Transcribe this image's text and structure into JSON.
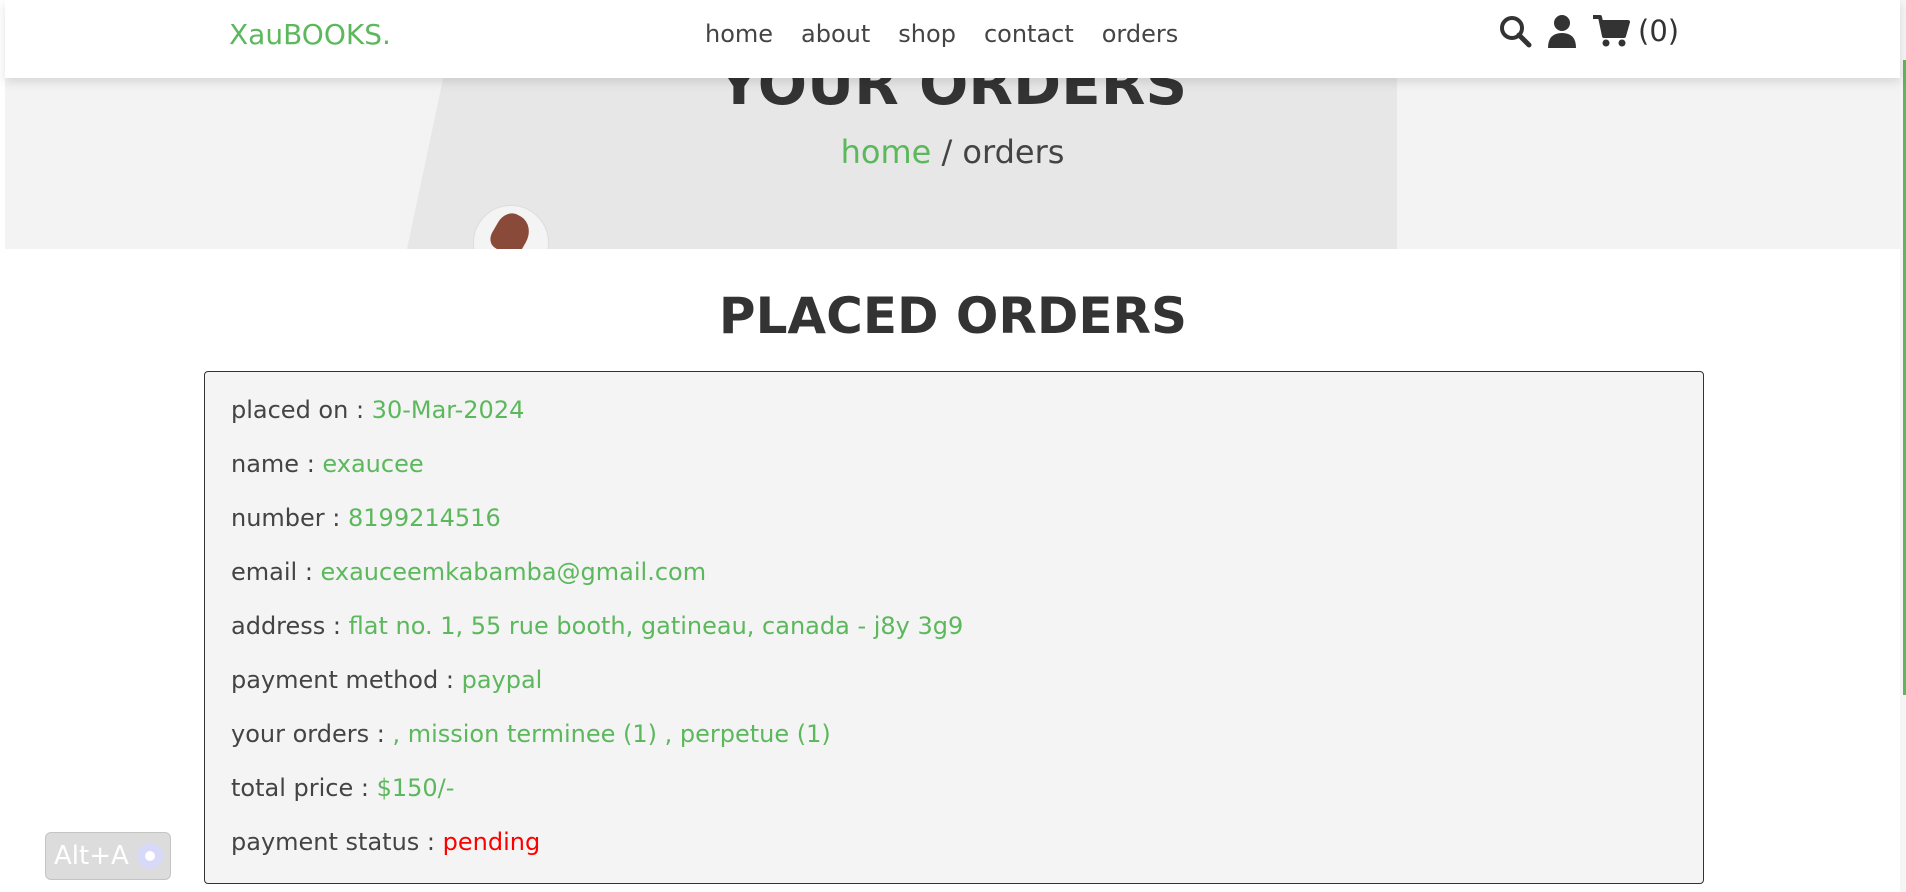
{
  "header": {
    "logo": "XauBOOKS.",
    "nav": [
      "home",
      "about",
      "shop",
      "contact",
      "orders"
    ],
    "cart_count": "(0)",
    "icons": [
      "search-icon",
      "user-icon",
      "cart-icon"
    ]
  },
  "hero": {
    "title": "YOUR ORDERS",
    "breadcrumb_home": "home",
    "breadcrumb_sep": " / ",
    "breadcrumb_current": "orders"
  },
  "section_title": "PLACED ORDERS",
  "order": {
    "placed_on_label": "placed on : ",
    "placed_on": "30-Mar-2024",
    "name_label": "name : ",
    "name": "exaucee",
    "number_label": "number : ",
    "number": "8199214516",
    "email_label": "email : ",
    "email": "exauceemkabamba@gmail.com",
    "address_label": "address : ",
    "address": "flat no. 1, 55 rue booth, gatineau, canada - j8y 3g9",
    "payment_method_label": "payment method : ",
    "payment_method": "paypal",
    "your_orders_label": "your orders : ",
    "your_orders": ", mission terminee (1) , perpetue (1)",
    "total_price_label": "total price : ",
    "total_price": "$150/-",
    "payment_status_label": "payment status : ",
    "payment_status": "pending"
  },
  "widget": {
    "label": "Alt+A"
  },
  "colors": {
    "accent": "#5cb85c",
    "pending": "#ff0000",
    "text": "#333333"
  }
}
